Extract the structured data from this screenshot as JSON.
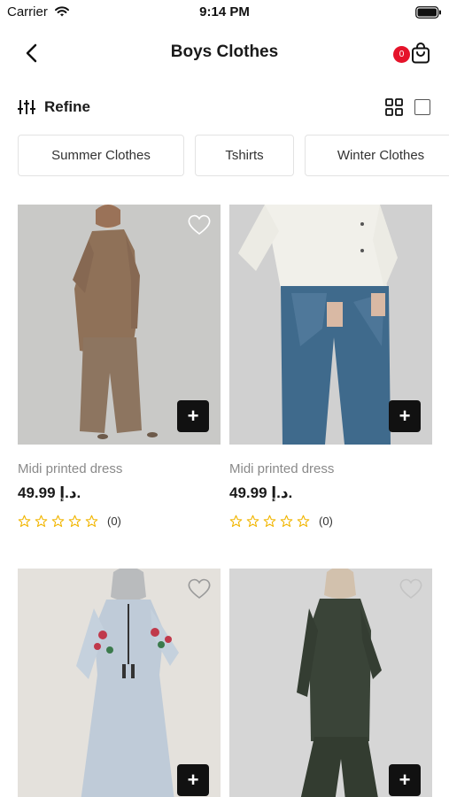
{
  "status_bar": {
    "carrier": "Carrier",
    "time": "9:14 PM"
  },
  "header": {
    "title": "Boys Clothes",
    "cart_count": "0"
  },
  "toolbar": {
    "refine_label": "Refine"
  },
  "categories": [
    "Summer Clothes",
    "Tshirts",
    "Winter Clothes"
  ],
  "products": [
    {
      "name": "Midi printed dress",
      "price": "49.99 د.إ.",
      "rating": 0,
      "rating_count": "(0)",
      "image": "tan-tunic-set"
    },
    {
      "name": "Midi printed dress",
      "price": "49.99 د.إ.",
      "rating": 0,
      "rating_count": "(0)",
      "image": "white-shirt-blue-jeans"
    },
    {
      "name": "",
      "price": "",
      "rating": 0,
      "rating_count": "",
      "image": "light-blue-embroidered-dress"
    },
    {
      "name": "",
      "price": "",
      "rating": 0,
      "rating_count": "",
      "image": "dark-green-tunic-set"
    }
  ],
  "icons": {
    "back": "chevron-left-icon",
    "cart": "shopping-bag-icon",
    "refine": "sliders-icon",
    "grid": "grid-icon",
    "list": "square-icon",
    "favorite": "heart-outline-icon",
    "add": "plus-icon",
    "star": "star-outline-icon"
  },
  "colors": {
    "badge": "#e5132a",
    "star": "#f2b705",
    "add_button": "#111111",
    "accent_text": "#1a1a1a"
  }
}
